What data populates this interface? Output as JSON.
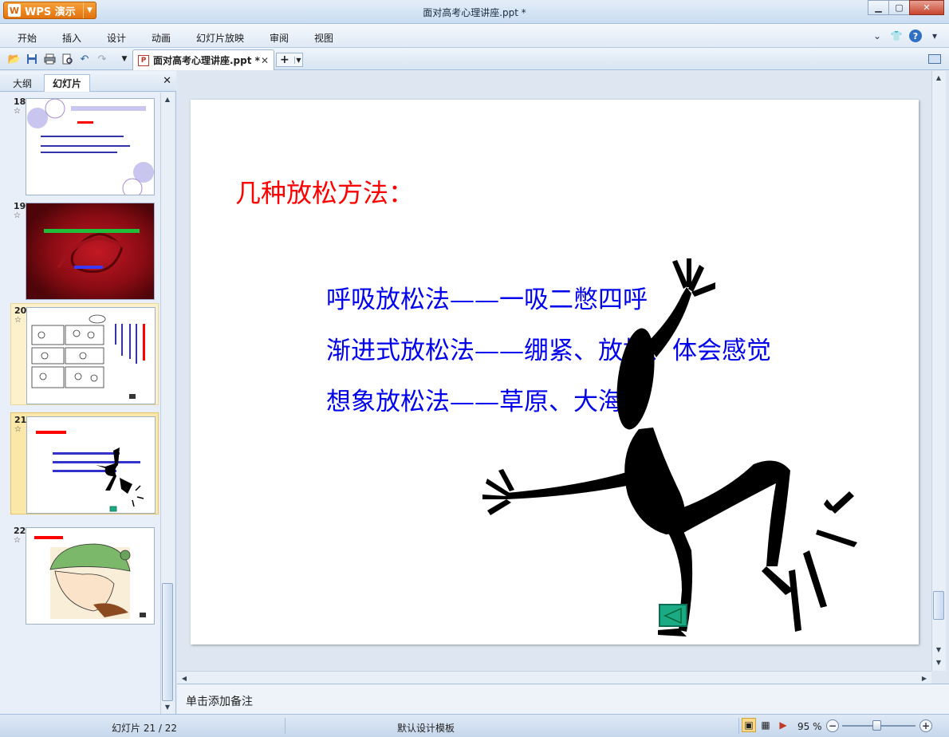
{
  "app": {
    "button_label": "WPS 演示",
    "logo_glyph": "W",
    "window_title": "面对高考心理讲座.ppt *"
  },
  "menu": {
    "items": [
      "开始",
      "插入",
      "设计",
      "动画",
      "幻灯片放映",
      "审阅",
      "视图"
    ]
  },
  "document_tab": {
    "label": "面对高考心理讲座.ppt *",
    "new_tab_symbol": "+"
  },
  "left_panel": {
    "tabs": [
      "大纲",
      "幻灯片"
    ],
    "active_tab": "幻灯片",
    "slides": [
      {
        "num": "18",
        "star": "☆"
      },
      {
        "num": "19",
        "star": "☆"
      },
      {
        "num": "20",
        "star": "☆"
      },
      {
        "num": "21",
        "star": "☆",
        "selected": true
      },
      {
        "num": "22",
        "star": "☆"
      }
    ]
  },
  "slide": {
    "title": "几种放松方法：",
    "lines": [
      "呼吸放松法——一吸二憋四呼",
      "渐进式放松法——绷紧、放松、体会感觉",
      "想象放松法——草原、大海等"
    ],
    "title_color": "#ff0000",
    "body_color": "#0000ee"
  },
  "notes": {
    "placeholder": "单击添加备注"
  },
  "status": {
    "slide_indicator": "幻灯片 21 / 22",
    "template": "默认设计模板",
    "zoom": "95 %",
    "zoom_level_percent": 95
  },
  "colors": {
    "accent": "#e2720d",
    "panel": "#e3ecf7",
    "selection": "#fbe7a7"
  }
}
